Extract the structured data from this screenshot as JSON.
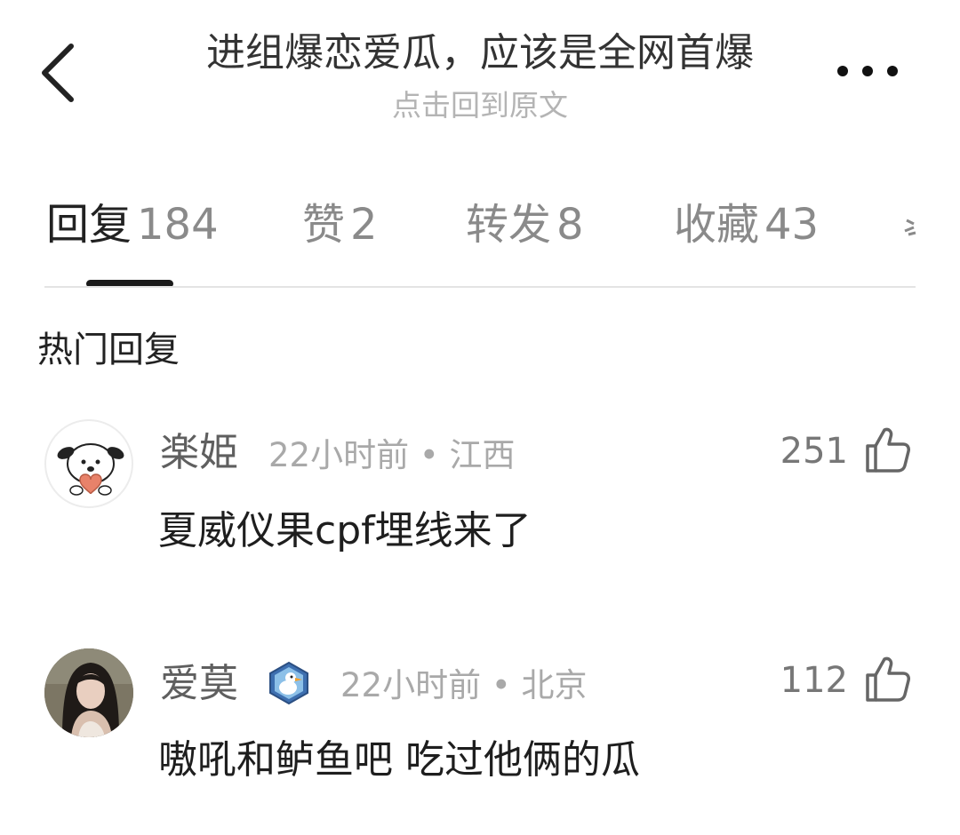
{
  "header": {
    "title": "进组爆恋爱瓜，应该是全网首爆",
    "subtitle": "点击回到原文"
  },
  "tabs": [
    {
      "label": "回复",
      "count": "184"
    },
    {
      "label": "赞",
      "count": "2"
    },
    {
      "label": "转发",
      "count": "8"
    },
    {
      "label": "收藏",
      "count": "43"
    }
  ],
  "section": {
    "title": "热门回复"
  },
  "comments": [
    {
      "user": "楽姫",
      "time": "22小时前",
      "location": "江西",
      "likes": "251",
      "text": "夏威仪果cpf埋线来了"
    },
    {
      "user": "爱莫",
      "time": "22小时前",
      "location": "北京",
      "likes": "112",
      "text": "嗷吼和鲈鱼吧 吃过他俩的瓜"
    }
  ],
  "separator": " • ",
  "colors": {
    "title": "#333333",
    "subtitle": "#b4b4b4",
    "tab_active": "#222222",
    "tab_inactive": "#8a8a8a",
    "indicator": "#1a1a1a",
    "username": "#5f5f5f",
    "meta": "#a9a9a9"
  },
  "icons": {
    "back": "chevron-left-icon",
    "more": "more-dots-icon",
    "like": "thumbs-up-icon",
    "badge": "duck-badge-icon"
  }
}
